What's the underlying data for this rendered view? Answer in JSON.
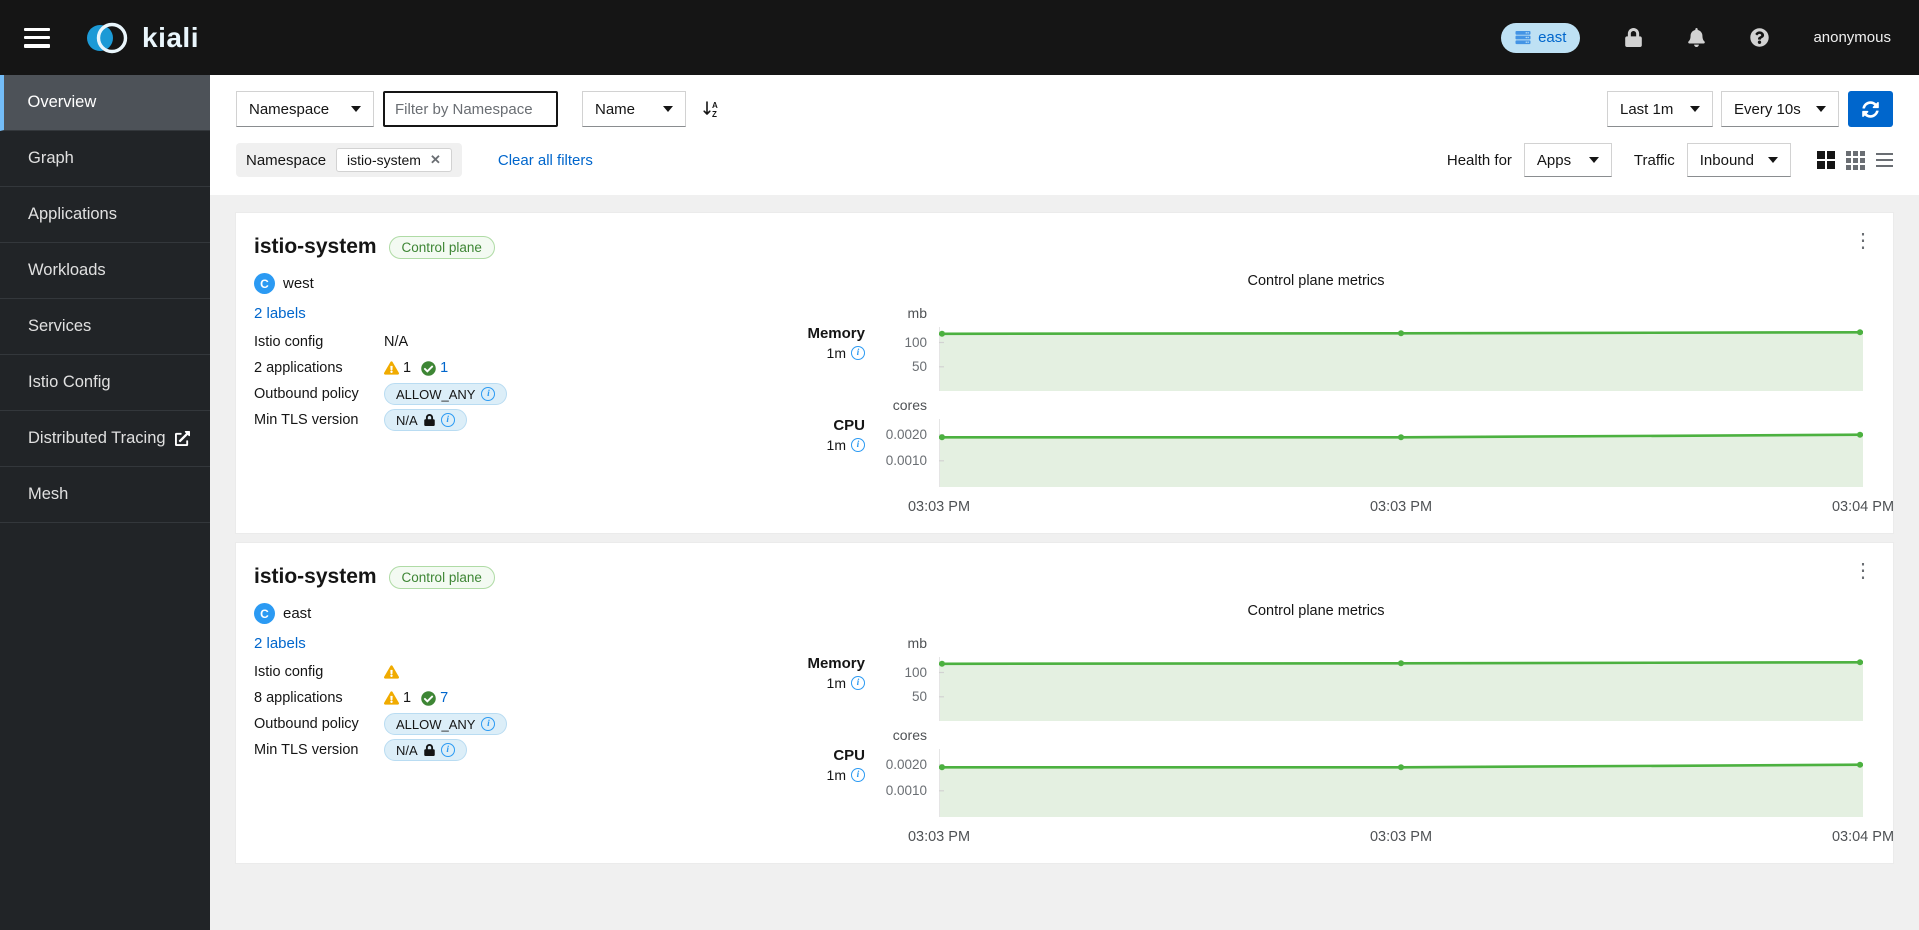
{
  "masthead": {
    "brand": "kiali",
    "cluster_badge": "east",
    "username": "anonymous"
  },
  "sidebar": {
    "items": [
      {
        "label": "Overview",
        "active": true
      },
      {
        "label": "Graph"
      },
      {
        "label": "Applications"
      },
      {
        "label": "Workloads"
      },
      {
        "label": "Services"
      },
      {
        "label": "Istio Config"
      },
      {
        "label": "Distributed Tracing",
        "external": true
      },
      {
        "label": "Mesh"
      }
    ]
  },
  "toolbar": {
    "filter_type": "Namespace",
    "filter_placeholder": "Filter by Namespace",
    "sort_by": "Name",
    "duration": "Last 1m",
    "refresh_interval": "Every 10s"
  },
  "filters": {
    "chip_group_label": "Namespace",
    "chip": "istio-system",
    "clear_all": "Clear all filters",
    "health_for_label": "Health for",
    "health_for": "Apps",
    "traffic_label": "Traffic",
    "traffic": "Inbound"
  },
  "colors": {
    "accent_blue": "#0066cc",
    "success_green": "#3e8635",
    "warning_orange": "#f0ab00",
    "chart_green": "#4CB140"
  },
  "cards": [
    {
      "title": "istio-system",
      "badge": "Control plane",
      "cluster": "west",
      "labels_link": "2 labels",
      "rows": {
        "istio_config_label": "Istio config",
        "istio_config_value": "N/A",
        "applications_label": "2 applications",
        "warning_count": "1",
        "healthy_count": "1",
        "outbound_label": "Outbound policy",
        "outbound_value": "ALLOW_ANY",
        "tls_label": "Min TLS version",
        "tls_value": "N/A"
      },
      "chart_title": "Control plane metrics",
      "chart_data": {
        "type": "area",
        "x_labels": [
          "03:03 PM",
          "03:03 PM",
          "03:04 PM"
        ],
        "memory": {
          "name": "Memory",
          "window": "1m",
          "unit": "mb",
          "values": [
            118,
            119,
            121
          ],
          "ylim": [
            0,
            132
          ],
          "ticks": [
            {
              "label": "100",
              "value": 100
            },
            {
              "label": "50",
              "value": 50
            }
          ]
        },
        "cpu": {
          "name": "CPU",
          "window": "1m",
          "unit": "cores",
          "values": [
            0.0019,
            0.0019,
            0.002
          ],
          "ylim": [
            0,
            0.0026
          ],
          "ticks": [
            {
              "label": "0.0020",
              "value": 0.002
            },
            {
              "label": "0.0010",
              "value": 0.001
            }
          ]
        }
      }
    },
    {
      "title": "istio-system",
      "badge": "Control plane",
      "cluster": "east",
      "labels_link": "2 labels",
      "rows": {
        "istio_config_label": "Istio config",
        "applications_label": "8 applications",
        "warning_count": "1",
        "healthy_count": "7",
        "outbound_label": "Outbound policy",
        "outbound_value": "ALLOW_ANY",
        "tls_label": "Min TLS version",
        "tls_value": "N/A"
      },
      "chart_title": "Control plane metrics",
      "chart_data": {
        "type": "area",
        "x_labels": [
          "03:03 PM",
          "03:03 PM",
          "03:04 PM"
        ],
        "memory": {
          "name": "Memory",
          "window": "1m",
          "unit": "mb",
          "values": [
            118,
            119,
            121
          ],
          "ylim": [
            0,
            132
          ],
          "ticks": [
            {
              "label": "100",
              "value": 100
            },
            {
              "label": "50",
              "value": 50
            }
          ]
        },
        "cpu": {
          "name": "CPU",
          "window": "1m",
          "unit": "cores",
          "values": [
            0.0019,
            0.0019,
            0.002
          ],
          "ylim": [
            0,
            0.0026
          ],
          "ticks": [
            {
              "label": "0.0020",
              "value": 0.002
            },
            {
              "label": "0.0010",
              "value": 0.001
            }
          ]
        }
      }
    }
  ]
}
